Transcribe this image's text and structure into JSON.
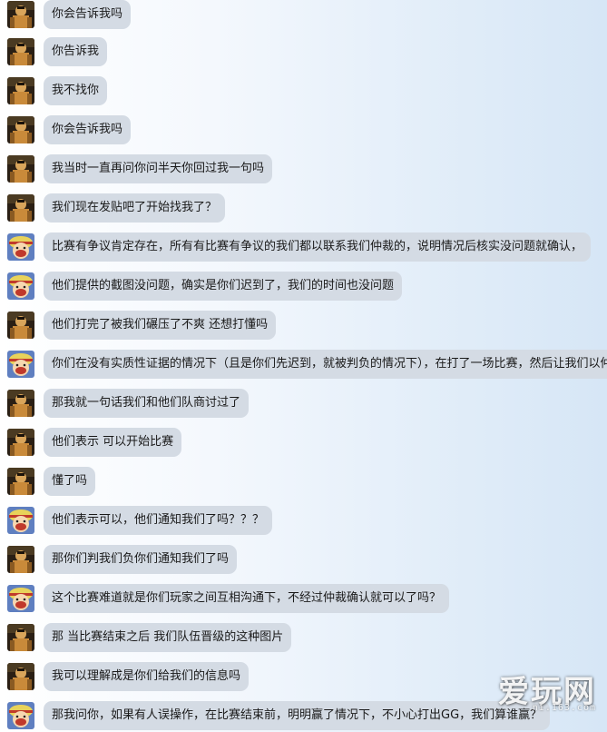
{
  "colors": {
    "bubble": "#d4dbe4",
    "text": "#1a1a1a"
  },
  "messages": [
    {
      "avatar": "user-a-avatar",
      "text": "你会告诉我吗"
    },
    {
      "avatar": "user-a-avatar",
      "text": "你告诉我"
    },
    {
      "avatar": "user-a-avatar",
      "text": "我不找你"
    },
    {
      "avatar": "user-a-avatar",
      "text": "你会告诉我吗"
    },
    {
      "avatar": "user-a-avatar",
      "text": "我当时一直再问你问半天你回过我一句吗"
    },
    {
      "avatar": "user-a-avatar",
      "text": "我们现在发贴吧了开始找我了？"
    },
    {
      "avatar": "user-b-avatar",
      "text": "比赛有争议肯定存在，所有有比赛有争议的我们都以联系我们仲裁的，说明情况后核实没问题就确认，"
    },
    {
      "avatar": "user-b-avatar",
      "text": "他们提供的截图没问题，确实是你们迟到了，我们的时间也没问题"
    },
    {
      "avatar": "user-a-avatar",
      "text": "他们打完了被我们碾压了不爽 还想打懂吗"
    },
    {
      "avatar": "user-b-avatar",
      "text": "你们在没有实质性证据的情况下（且是你们先迟到，就被判负的情况下），在打了一场比赛，然后让我们以仲"
    },
    {
      "avatar": "user-a-avatar",
      "text": "那我就一句话我们和他们队商讨过了"
    },
    {
      "avatar": "user-a-avatar",
      "text": "他们表示 可以开始比赛"
    },
    {
      "avatar": "user-a-avatar",
      "text": "懂了吗"
    },
    {
      "avatar": "user-b-avatar",
      "text": "他们表示可以，他们通知我们了吗？？？"
    },
    {
      "avatar": "user-a-avatar",
      "text": "那你们判我们负你们通知我们了吗"
    },
    {
      "avatar": "user-b-avatar",
      "text": "这个比赛难道就是你们玩家之间互相沟通下，不经过仲裁确认就可以了吗？"
    },
    {
      "avatar": "user-a-avatar",
      "text": "那 当比赛结束之后 我们队伍晋级的这种图片"
    },
    {
      "avatar": "user-a-avatar",
      "text": "我可以理解成是你们给我们的信息吗"
    },
    {
      "avatar": "user-b-avatar",
      "text": "那我问你，如果有人误操作，在比赛结束前，明明赢了情况下，不小心打出GG，我们算谁赢？"
    }
  ],
  "watermark": {
    "title": "爱玩网",
    "domain": "ni.163.com"
  }
}
